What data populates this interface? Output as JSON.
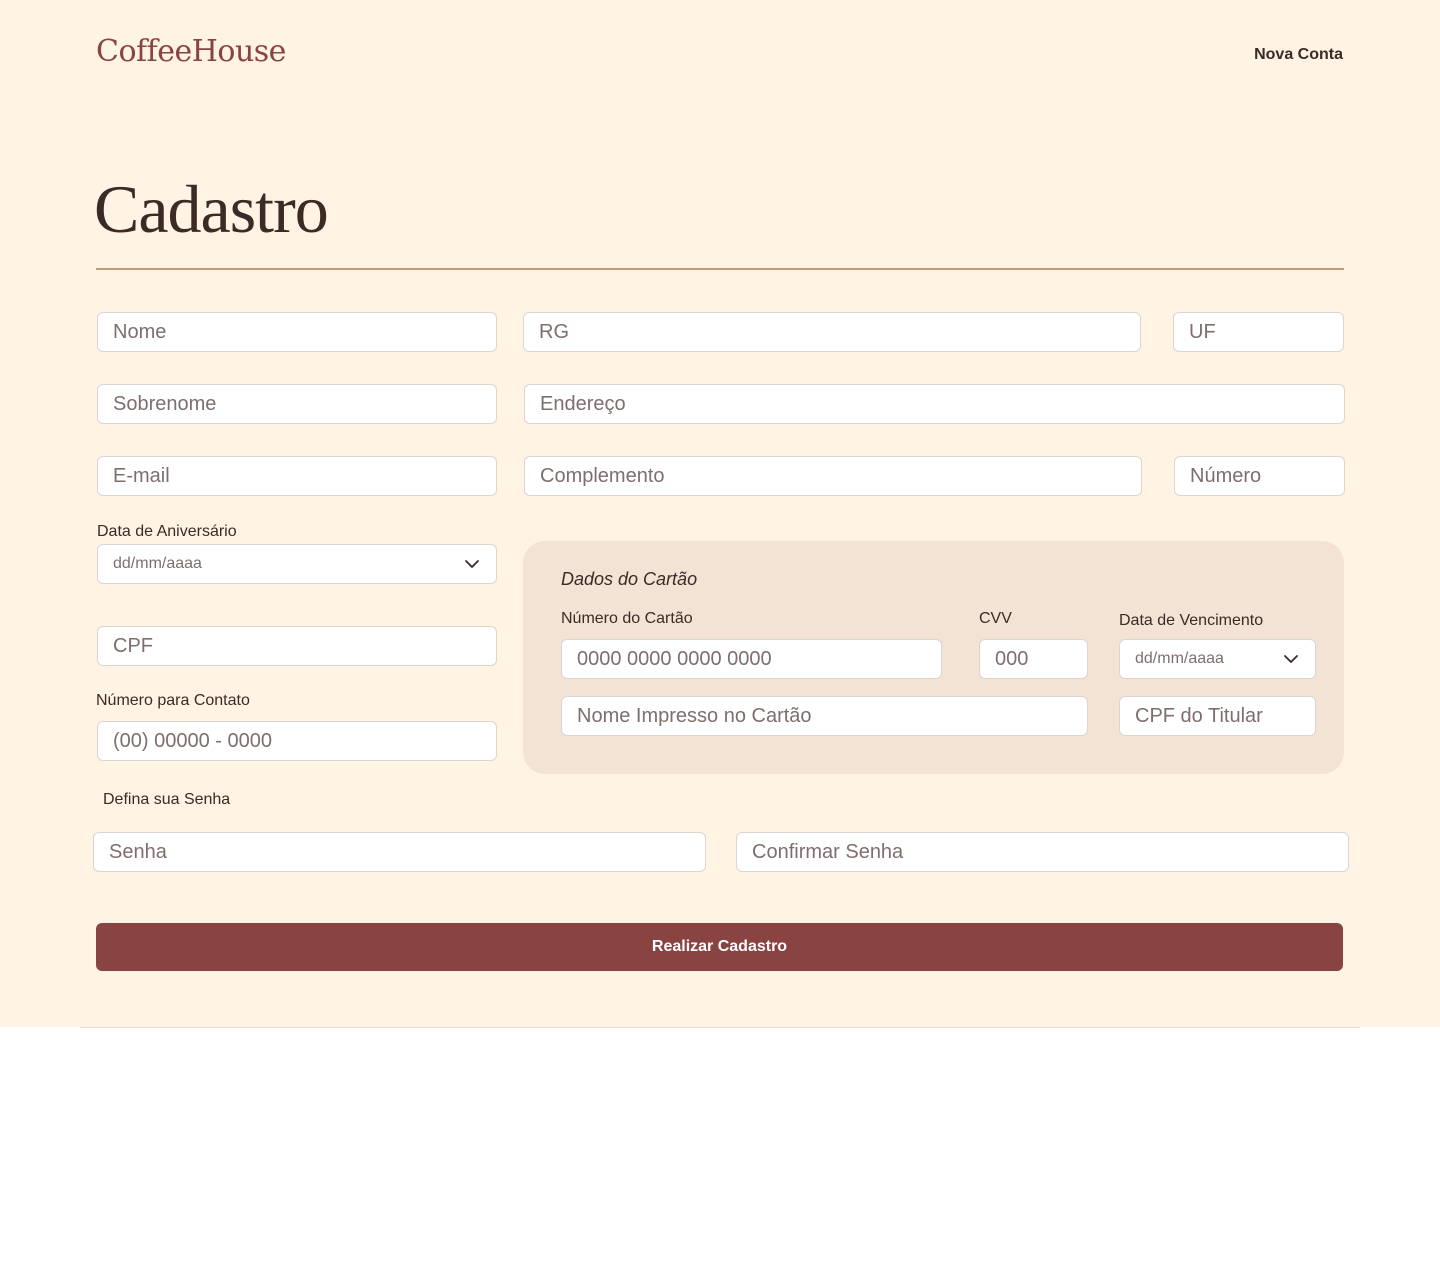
{
  "header": {
    "logo": "CoffeeHouse",
    "nav_link": "Nova Conta"
  },
  "page": {
    "title": "Cadastro"
  },
  "form": {
    "nome_placeholder": "Nome",
    "rg_placeholder": "RG",
    "uf_placeholder": "UF",
    "sobrenome_placeholder": "Sobrenome",
    "endereco_placeholder": "Endereço",
    "email_placeholder": "E-mail",
    "complemento_placeholder": "Complemento",
    "numero_placeholder": "Número",
    "birthday_label": "Data de Aniversário",
    "birthday_placeholder": "dd/mm/aaaa",
    "cpf_placeholder": "CPF",
    "contact_label": "Número para Contato",
    "contact_placeholder": "(00) 00000 - 0000",
    "password_section_label": "Defina sua Senha",
    "senha_placeholder": "Senha",
    "confirmar_senha_placeholder": "Confirmar Senha",
    "submit_label": "Realizar Cadastro"
  },
  "card": {
    "title": "Dados do Cartão",
    "number_label": "Número do Cartão",
    "number_placeholder": "0000 0000 0000 0000",
    "cvv_label": "CVV",
    "cvv_placeholder": "000",
    "expiry_label": "Data de Vencimento",
    "expiry_placeholder": "dd/mm/aaaa",
    "name_placeholder": "Nome Impresso no Cartão",
    "holder_cpf_placeholder": "CPF do Titular"
  },
  "icons": {
    "chevron": "chevron-down-icon"
  },
  "colors": {
    "background": "#fff3e4",
    "brand": "#8a4440",
    "button": "#894442",
    "card_panel": "#f2e3d5",
    "rule": "#c49a77",
    "text": "#3b2a25"
  }
}
